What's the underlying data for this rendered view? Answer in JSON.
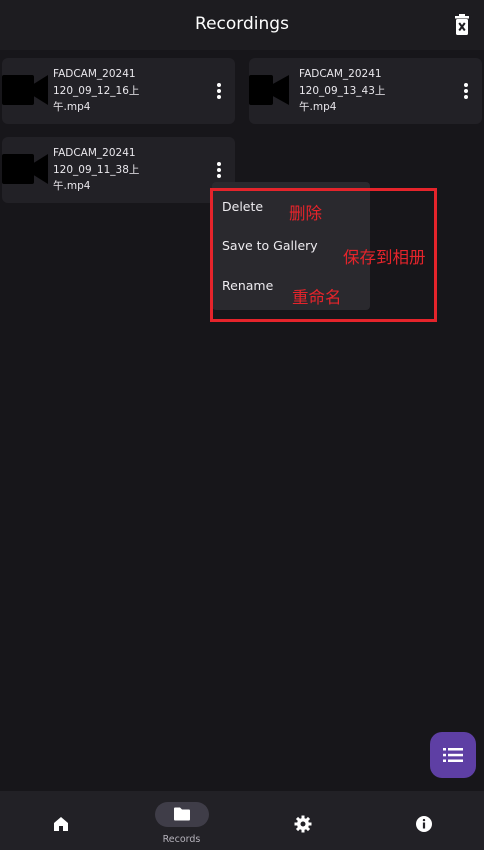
{
  "header": {
    "title": "Recordings",
    "delete_all_icon": "trash-icon"
  },
  "recordings": [
    {
      "name": "FADCAM_20241 120_09_12_16上 午.mp4",
      "lines": [
        "FADCAM_20241",
        "120_09_12_16上",
        "午.mp4"
      ]
    },
    {
      "name": "FADCAM_20241 120_09_13_43上 午.mp4",
      "lines": [
        "FADCAM_20241",
        "120_09_13_43上",
        "午.mp4"
      ]
    },
    {
      "name": "FADCAM_20241 120_09_11_38上 午.mp4",
      "lines": [
        "FADCAM_20241",
        "120_09_11_38上",
        "午.mp4"
      ]
    }
  ],
  "context_menu": {
    "items": [
      {
        "label": "Delete",
        "annotation": "删除"
      },
      {
        "label": "Save to Gallery",
        "annotation": "保存到相册"
      },
      {
        "label": "Rename",
        "annotation": "重命名"
      }
    ],
    "annotation_color": "#e5242b"
  },
  "fab": {
    "icon": "list-icon",
    "color": "#5e3fa4"
  },
  "bottom_nav": {
    "items": [
      {
        "icon": "home-icon",
        "label": ""
      },
      {
        "icon": "folder-icon",
        "label": "Records",
        "active": true
      },
      {
        "icon": "gear-icon",
        "label": ""
      },
      {
        "icon": "info-icon",
        "label": ""
      }
    ]
  }
}
